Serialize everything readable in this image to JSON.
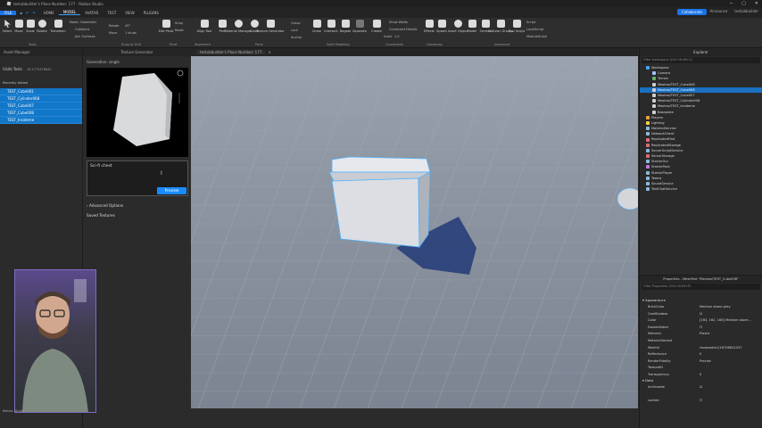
{
  "window": {
    "title": "testubbuilder's Place Number: 177 - Roblox Studio",
    "controls": [
      "─",
      "▢",
      "✕"
    ]
  },
  "menubar": {
    "file": "FILE",
    "tabs": [
      "HOME",
      "MODEL",
      "AVATAR",
      "TEST",
      "VIEW",
      "PLUGINS"
    ],
    "active_tab": "MODEL",
    "collaborate": "Collaborate",
    "right_items": [
      "Announce",
      "testubbuilder"
    ]
  },
  "ribbon": {
    "tools": [
      "Select",
      "Move",
      "Scale",
      "Rotate",
      "Transform"
    ],
    "tools_group": "Tools",
    "mode_label": "Mode:",
    "mode_value": "Geometric",
    "collisions": "Collisions",
    "join_surfaces": "Join Surfaces",
    "rotate_label": "Rotate",
    "rotate_value": "45°",
    "move_label": "Move",
    "move_value": "1 studs",
    "snap_group": "Snap to Grid",
    "gen_pivot": "Edit Pivot",
    "snap": "Snap",
    "reset": "Reset",
    "pivot_group": "Pivot",
    "part": "Part",
    "material_manager": "Material Manager",
    "color": "Color",
    "texture_generator": "Texture Generator",
    "parts_group": "Parts",
    "group": "Group",
    "lock": "Lock",
    "anchor": "Anchor",
    "align_tool": "Align Tool",
    "alignment_group": "Alignment",
    "union": "Union",
    "intersect": "Intersect",
    "negate": "Negate",
    "separate": "Separate",
    "solid_modeling_group": "Solid Modeling",
    "create": "Create",
    "show_welds": "Show Welds",
    "constraint_details": "Constraint Details",
    "scale": "Scale",
    "scale_value": "1.0",
    "constraints_group": "Constraints",
    "effects": "Effects",
    "spawn": "Spawn",
    "gameplay_group": "Gameplay",
    "insert_object": "Insert Object",
    "model": "Model",
    "service": "Service",
    "collision_groups": "Collision Groups",
    "run_script": "Run Script",
    "script": "Script",
    "local_script": "LocalScript",
    "module_script": "ModuleScript",
    "advanced_group": "Advanced"
  },
  "asset_manager": {
    "tab": "Asset Manager",
    "subtab": "Texture Generator",
    "header": "Visits Tests",
    "folder_info": "ID 2770476645",
    "recently_added": "Recently Added",
    "items": [
      "TEST_Cube001",
      "TEST_Cylinder008",
      "TEST_Cube007",
      "TEST_Cube008",
      "TEST_Insideme"
    ]
  },
  "texture_generator": {
    "header": "Generation: single",
    "prompt": "Sci-fi chest",
    "preview_button": "Preview",
    "advanced_options": "Advanced Options",
    "saved_textures": "Saved Textures"
  },
  "viewport": {
    "tab": "testubbuilder's Place Number: 177"
  },
  "explorer": {
    "title": "Explorer",
    "filter_placeholder": "Filter workspace (Ctrl+Shift+X)",
    "rows": [
      {
        "label": "Workspace",
        "indent": 1,
        "color": "#4aa3ff",
        "selected": false
      },
      {
        "label": "Camera",
        "indent": 2,
        "color": "#a0c4ff",
        "selected": false
      },
      {
        "label": "Terrain",
        "indent": 2,
        "color": "#69b06b",
        "selected": false
      },
      {
        "label": "Meshes/TEST_Cube008",
        "indent": 2,
        "color": "#cfcfcf",
        "selected": false
      },
      {
        "label": "Meshes/TEST_Cube008",
        "indent": 2,
        "color": "#cfcfcf",
        "selected": true
      },
      {
        "label": "Meshes/TEST_Cube007",
        "indent": 2,
        "color": "#cfcfcf",
        "selected": false
      },
      {
        "label": "Meshes/TEST_Cylinder008",
        "indent": 2,
        "color": "#cfcfcf",
        "selected": false
      },
      {
        "label": "Meshes/TEST_Insideme",
        "indent": 2,
        "color": "#cfcfcf",
        "selected": false
      },
      {
        "label": "Baseplate",
        "indent": 2,
        "color": "#cfcfcf",
        "selected": false
      },
      {
        "label": "Players",
        "indent": 1,
        "color": "#e6a23c",
        "selected": false
      },
      {
        "label": "Lighting",
        "indent": 1,
        "color": "#f2d04a",
        "selected": false
      },
      {
        "label": "MaterialService",
        "indent": 1,
        "color": "#8fb8de",
        "selected": false
      },
      {
        "label": "NetworkClient",
        "indent": 1,
        "color": "#8fb8de",
        "selected": false
      },
      {
        "label": "ReplicatedFirst",
        "indent": 1,
        "color": "#e06c75",
        "selected": false
      },
      {
        "label": "ReplicatedStorage",
        "indent": 1,
        "color": "#e06c75",
        "selected": false
      },
      {
        "label": "ServerScriptService",
        "indent": 1,
        "color": "#8fb8de",
        "selected": false
      },
      {
        "label": "ServerStorage",
        "indent": 1,
        "color": "#e06c75",
        "selected": false
      },
      {
        "label": "StarterGui",
        "indent": 1,
        "color": "#8fb8de",
        "selected": false
      },
      {
        "label": "StarterPack",
        "indent": 1,
        "color": "#c678dd",
        "selected": false
      },
      {
        "label": "StarterPlayer",
        "indent": 1,
        "color": "#8fb8de",
        "selected": false
      },
      {
        "label": "Teams",
        "indent": 1,
        "color": "#8fb8de",
        "selected": false
      },
      {
        "label": "SoundService",
        "indent": 1,
        "color": "#8fb8de",
        "selected": false
      },
      {
        "label": "TextChatService",
        "indent": 1,
        "color": "#8fb8de",
        "selected": false
      }
    ]
  },
  "properties": {
    "title": "Properties - MeshPart \"Meshes/TEST_Cube008\"",
    "filter_placeholder": "Filter Properties (Ctrl+Shift+P)",
    "sections": [
      "Appearance",
      "Data"
    ],
    "rows": [
      {
        "name": "BrickColor",
        "value": "Medium stone grey"
      },
      {
        "name": "CastShadow",
        "value": "☑"
      },
      {
        "name": "Color",
        "value": "[163, 162, 165] Medium stone..."
      },
      {
        "name": "DoubleSided",
        "value": "☐"
      },
      {
        "name": "Material",
        "value": "Plastic"
      },
      {
        "name": "MaterialVariant",
        "value": ""
      },
      {
        "name": "MeshId",
        "value": "rbxassetid://16708831037"
      },
      {
        "name": "Reflectance",
        "value": "0"
      },
      {
        "name": "RenderFidelity",
        "value": "Precise"
      },
      {
        "name": "TextureID",
        "value": ""
      },
      {
        "name": "Transparency",
        "value": "0"
      }
    ],
    "data_rows": [
      {
        "name": "Archivable",
        "value": "☑"
      },
      {
        "name": "",
        "value": ""
      },
      {
        "name": "Locked",
        "value": "☐"
      }
    ]
  },
  "webcam": {
    "caption": "Roblox Studio"
  },
  "colors": {
    "accent": "#1b6fc1",
    "list_selected": "#1177c9",
    "preview_button": "#1a8cff",
    "collaborate": "#1a73e8"
  }
}
